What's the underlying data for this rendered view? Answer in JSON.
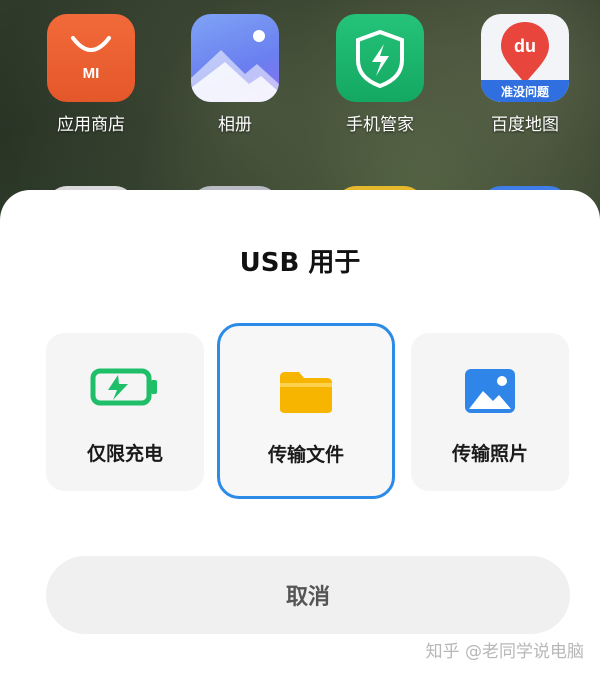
{
  "home_screen": {
    "apps": [
      {
        "label": "应用商店",
        "icon_text": "MI"
      },
      {
        "label": "相册"
      },
      {
        "label": "手机管家"
      },
      {
        "label": "百度地图",
        "icon_text": "du",
        "icon_banner": "准没问题"
      }
    ],
    "peek_icon_colors": [
      "#d9d9dc",
      "#b9bcc4",
      "#e6b92c",
      "#3f7de8"
    ]
  },
  "usb_sheet": {
    "title": "USB 用于",
    "options": [
      {
        "label": "仅限充电",
        "icon": "battery-charging-icon",
        "selected": false
      },
      {
        "label": "传输文件",
        "icon": "folder-icon",
        "selected": true
      },
      {
        "label": "传输照片",
        "icon": "photo-icon",
        "selected": false
      }
    ],
    "cancel_label": "取消"
  },
  "watermark": "知乎 @老同学说电脑",
  "colors": {
    "accent_selected_border": "#2b8be6",
    "battery_green": "#1fbf6a",
    "folder_yellow": "#f7b500",
    "photo_blue": "#2f86e8"
  }
}
